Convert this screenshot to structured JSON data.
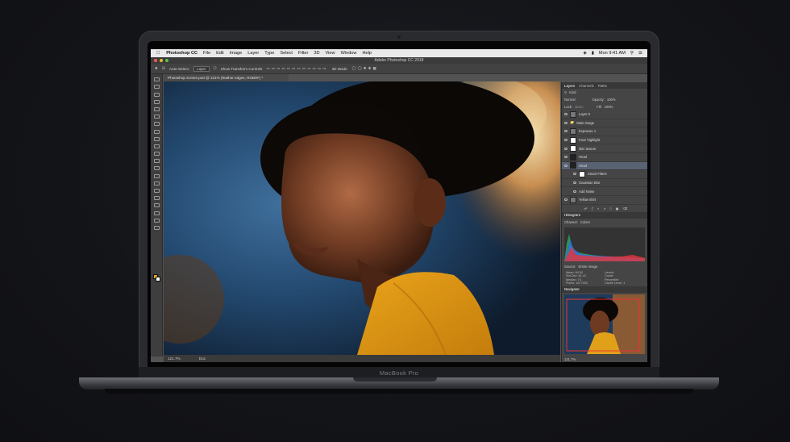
{
  "device": {
    "brand": "MacBook Pro"
  },
  "menubar": {
    "apple_icon": "apple-icon",
    "app": "Photoshop CC",
    "items": [
      "File",
      "Edit",
      "Image",
      "Layer",
      "Type",
      "Select",
      "Filter",
      "3D",
      "View",
      "Window",
      "Help"
    ],
    "clock": "Mon 9:41 AM"
  },
  "window": {
    "title": "Adobe Photoshop CC 2018"
  },
  "options": {
    "auto_select": "Auto-Select:",
    "auto_select_value": "Layer",
    "transform": "Show Transform Controls",
    "mode3d": "3D Mode:"
  },
  "document": {
    "tab": "Photoshop screen.psd @ 121% (feather edges, RGB/8*) *",
    "zoom": "121.7%",
    "doc_info": "Doc"
  },
  "layers": {
    "tabs": [
      "Layers",
      "Channels",
      "Paths"
    ],
    "kind": "Kind",
    "blend": "Normal",
    "opacity_label": "Opacity:",
    "opacity": "100%",
    "lock_label": "Lock:",
    "fill_label": "Fill:",
    "fill": "100%",
    "items": [
      "Layer 0",
      "Main Image",
      "Exposure 1",
      "Face highlight",
      "skin texture",
      "Head",
      "Head",
      "Smart Filters",
      "Gaussian Blur",
      "Add Noise",
      "Yellow shirt"
    ]
  },
  "histogram": {
    "title": "Histogram",
    "channel_label": "Channel:",
    "channel": "Colors",
    "source_label": "Source:",
    "source": "Entire Image",
    "stats_left": [
      "Mean:",
      "Std Dev:",
      "Median:",
      "Pixels:"
    ],
    "stats_left_values": [
      "84.50",
      "61.41",
      "74",
      "1677202"
    ],
    "stats_right": [
      "Levels:",
      "Count:",
      "Percentile:",
      "Cache Level:"
    ],
    "stats_right_values": [
      "",
      "",
      "",
      "1"
    ]
  },
  "navigator": {
    "title": "Navigator",
    "zoom": "121.7%"
  }
}
